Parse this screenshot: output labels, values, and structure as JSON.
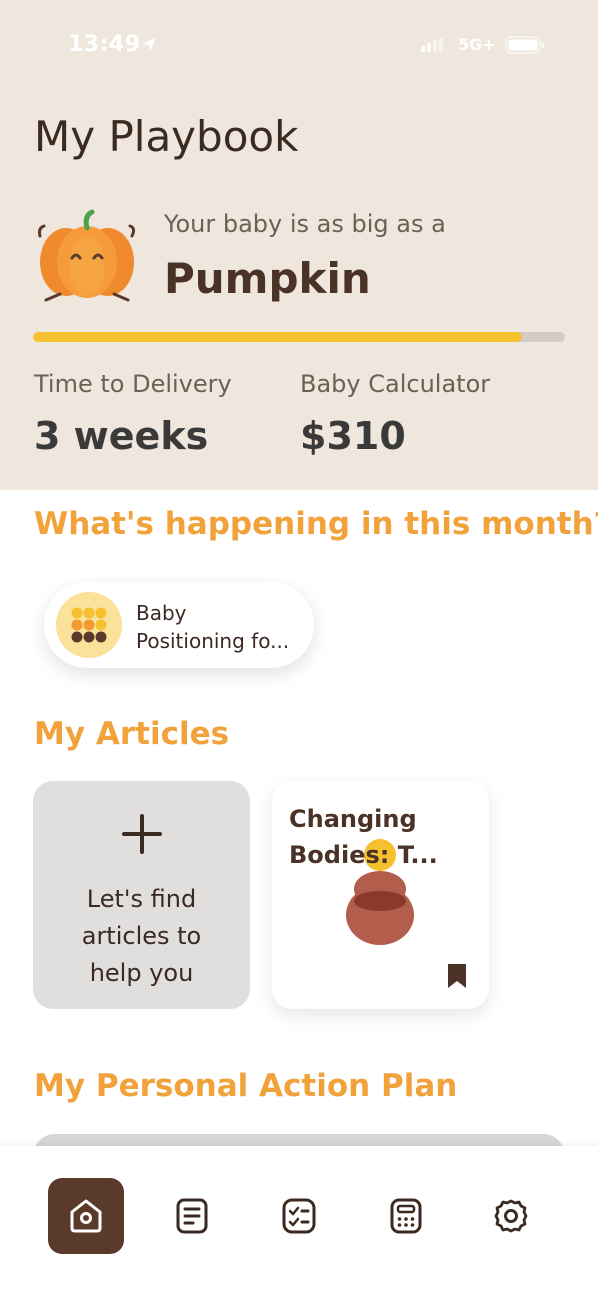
{
  "status_bar": {
    "time": "13:49",
    "network": "5G+"
  },
  "header": {
    "title": "My Playbook",
    "baby_size_prefix": "Your baby is as big as a",
    "baby_size": "Pumpkin",
    "progress": 0.92,
    "stats": [
      {
        "label": "Time to Delivery",
        "value": "3 weeks"
      },
      {
        "label": "Baby Calculator",
        "value": "$310"
      }
    ]
  },
  "month_section": {
    "heading": "What's happening in this month?",
    "items": [
      {
        "title_line1": "Baby",
        "title_line2": "Positioning fo..."
      }
    ]
  },
  "articles_section": {
    "heading": "My Articles",
    "add_card": {
      "line1": "Let's find",
      "line2": "articles to",
      "line3": "help you"
    },
    "articles": [
      {
        "title_line1": "Changing",
        "title_line2": "Bodies: T..."
      }
    ]
  },
  "plan_section": {
    "heading": "My Personal Action Plan"
  },
  "tab_bar": {
    "tabs": [
      {
        "icon": "home-icon",
        "active": true
      },
      {
        "icon": "articles-icon",
        "active": false
      },
      {
        "icon": "checklist-icon",
        "active": false
      },
      {
        "icon": "calculator-icon",
        "active": false
      },
      {
        "icon": "settings-icon",
        "active": false
      }
    ]
  },
  "colors": {
    "header_bg": "#efe7dd",
    "accent_orange": "#f2a23b",
    "progress_yellow": "#f6c12e",
    "dark_brown": "#5a3a2a"
  }
}
